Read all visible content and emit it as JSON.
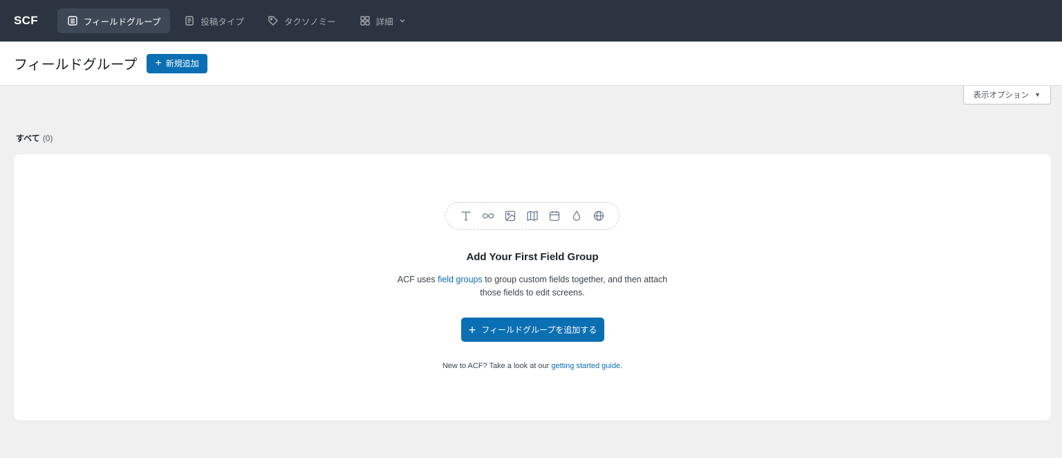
{
  "nav": {
    "logo": "SCF",
    "tabs": [
      {
        "label": "フィールドグループ",
        "icon": "list-icon",
        "active": true
      },
      {
        "label": "投稿タイプ",
        "icon": "document-icon"
      },
      {
        "label": "タクソノミー",
        "icon": "tag-icon"
      },
      {
        "label": "詳細",
        "icon": "grid-icon",
        "dropdown": true
      }
    ]
  },
  "header": {
    "title": "フィールドグループ",
    "add_new_label": "新規追加"
  },
  "screen_options": {
    "label": "表示オプション"
  },
  "filters": {
    "all_label": "すべて",
    "all_count": "(0)"
  },
  "empty_state": {
    "field_icons": [
      "text-icon",
      "infinity-icon",
      "image-icon",
      "map-icon",
      "calendar-icon",
      "color-drop-icon",
      "globe-icon"
    ],
    "title": "Add Your First Field Group",
    "desc_before": "ACF uses ",
    "desc_link": "field groups",
    "desc_after": " to group custom fields together, and then attach those fields to edit screens.",
    "add_button_label": "フィールドグループを追加する",
    "guide_before": "New to ACF? Take a look at our ",
    "guide_link": "getting started guide",
    "guide_after": "."
  },
  "colors": {
    "nav_bg": "#2c3441",
    "accent": "#0a6fb3",
    "page_bg": "#f0f0f1"
  }
}
